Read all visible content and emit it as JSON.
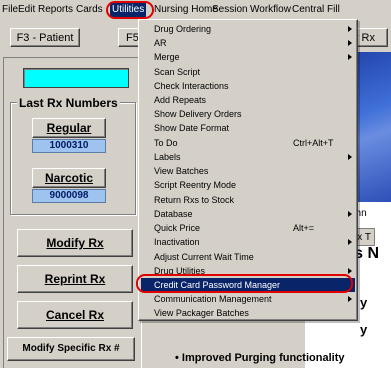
{
  "menubar": {
    "items": [
      "File",
      "Edit",
      "Reports",
      "Cards",
      "Utilities",
      "Nursing Home",
      "Session",
      "Workflow",
      "Central Fill"
    ]
  },
  "toolbar": {
    "patient_button": "F3 - Patient",
    "partial_button": "F5",
    "right_partial": "v Rx"
  },
  "left": {
    "group_title": "Last Rx Numbers",
    "regular_label": "Regular",
    "regular_number": "1000310",
    "narcotic_label": "Narcotic",
    "narcotic_number": "9000098",
    "modify_rx": "Modify Rx",
    "reprint_rx": "Reprint Rx",
    "cancel_rx": "Cancel Rx",
    "modify_specific": "Modify Specific Rx #"
  },
  "background": {
    "techn": "Techn",
    "rx_tab": "Rx T",
    "news_heading": "t's N",
    "news_y1": "y",
    "news_y2": "y",
    "bottom_news": "•   Improved Purging functionality"
  },
  "dropdown": {
    "items": [
      {
        "label": "Drug Ordering",
        "shortcut": "",
        "submenu": true
      },
      {
        "label": "AR",
        "shortcut": "",
        "submenu": true
      },
      {
        "label": "Merge",
        "shortcut": "",
        "submenu": true
      },
      {
        "label": "Scan Script",
        "shortcut": "",
        "submenu": false
      },
      {
        "label": "Check Interactions",
        "shortcut": "",
        "submenu": false
      },
      {
        "label": "Add Repeats",
        "shortcut": "",
        "submenu": false
      },
      {
        "label": "Show Delivery Orders",
        "shortcut": "",
        "submenu": false
      },
      {
        "label": "Show Date Format",
        "shortcut": "",
        "submenu": false
      },
      {
        "label": "To Do",
        "shortcut": "Ctrl+Alt+T",
        "submenu": false
      },
      {
        "label": "Labels",
        "shortcut": "",
        "submenu": true
      },
      {
        "label": "View Batches",
        "shortcut": "",
        "submenu": false
      },
      {
        "label": "Script Reentry Mode",
        "shortcut": "",
        "submenu": false
      },
      {
        "label": "Return Rxs to Stock",
        "shortcut": "",
        "submenu": false
      },
      {
        "label": "Database",
        "shortcut": "",
        "submenu": true
      },
      {
        "label": "Quick Price",
        "shortcut": "Alt+=",
        "submenu": false
      },
      {
        "label": "Inactivation",
        "shortcut": "",
        "submenu": true
      },
      {
        "label": "Adjust Current Wait Time",
        "shortcut": "",
        "submenu": false
      },
      {
        "label": "Drug Utilities",
        "shortcut": "",
        "submenu": true
      },
      {
        "label": "Credit Card Password Manager",
        "shortcut": "",
        "submenu": false
      },
      {
        "label": "Communication Management",
        "shortcut": "",
        "submenu": true
      },
      {
        "label": "View Packager Batches",
        "shortcut": "",
        "submenu": false
      }
    ]
  },
  "colors": {
    "highlight": "#0a246a",
    "annotation": "#e00000",
    "number_field": "#9ec3ef",
    "cyan_field": "#00ffff"
  }
}
